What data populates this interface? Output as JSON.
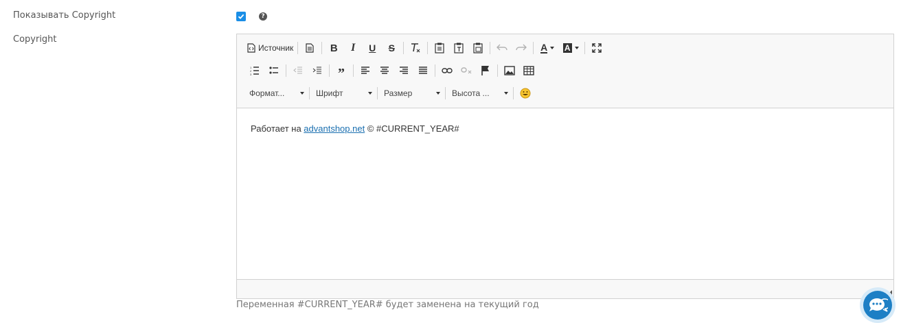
{
  "fields": {
    "show_copyright_label": "Показывать Copyright",
    "show_copyright_checked": true,
    "copyright_label": "Copyright"
  },
  "editor": {
    "toolbar": {
      "source_label": "Источник",
      "format_label": "Формат...",
      "font_label": "Шрифт",
      "size_label": "Размер",
      "height_label": "Высота ..."
    },
    "content": {
      "prefix": "Работает на ",
      "link_text": "advantshop.net",
      "suffix": " © #CURRENT_YEAR#"
    }
  },
  "hint": "Переменная #CURRENT_YEAR# будет заменена на текущий год",
  "colors": {
    "checkbox": "#1a8ee6",
    "link": "#1a6fb0",
    "chat_button": "#1d7fc5"
  },
  "icons": [
    "help-icon",
    "source-icon",
    "document-icon",
    "bold-icon",
    "italic-icon",
    "underline-icon",
    "strikethrough-icon",
    "remove-format-icon",
    "paste-icon",
    "paste-text-icon",
    "paste-word-icon",
    "undo-icon",
    "redo-icon",
    "text-color-icon",
    "background-color-icon",
    "maximize-icon",
    "numbered-list-icon",
    "bulleted-list-icon",
    "outdent-icon",
    "indent-icon",
    "blockquote-icon",
    "align-left-icon",
    "align-center-icon",
    "align-right-icon",
    "align-justify-icon",
    "link-icon",
    "unlink-icon",
    "anchor-flag-icon",
    "image-icon",
    "table-icon",
    "emoji-icon",
    "chat-icon"
  ]
}
